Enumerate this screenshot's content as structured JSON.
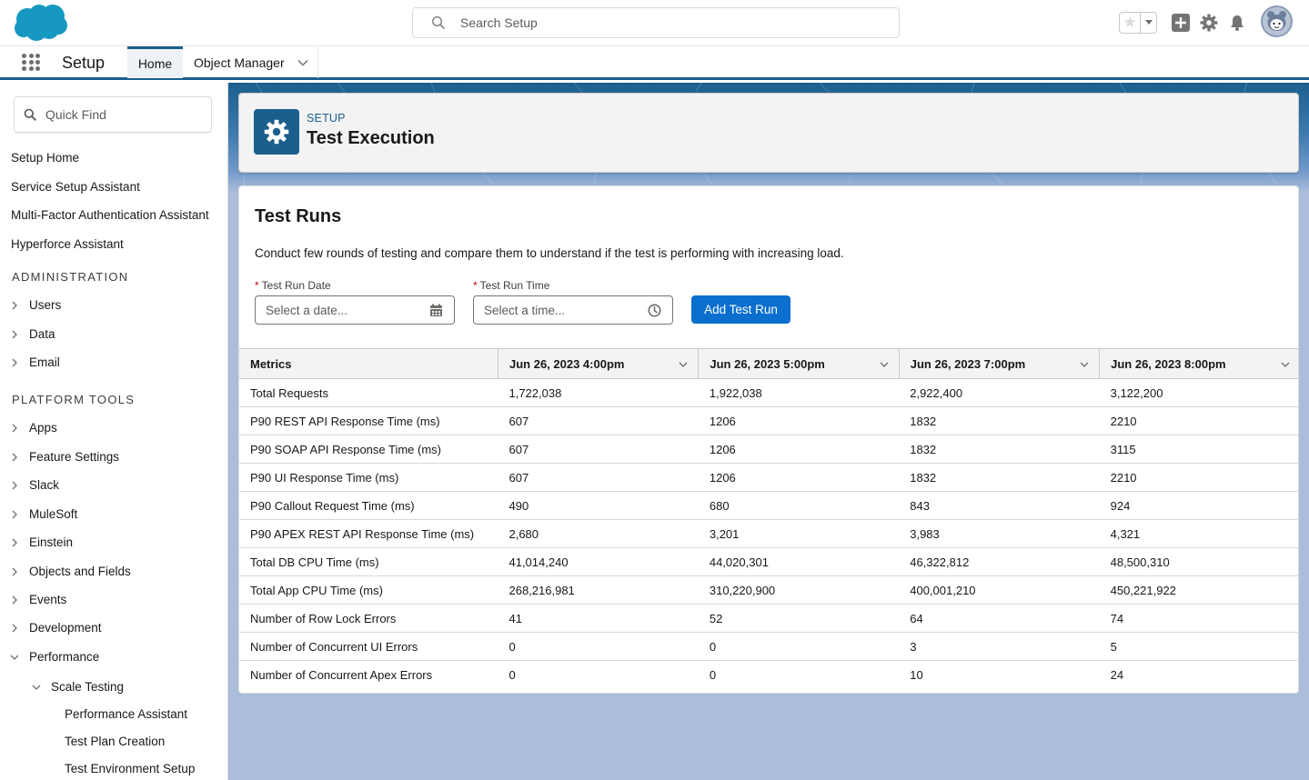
{
  "header": {
    "logo": "salesforce-cloud-logo",
    "search_placeholder": "Search Setup",
    "icons": [
      "favorites-star-icon",
      "favorites-dropdown-icon",
      "global-actions-plus-icon",
      "setup-gear-icon",
      "notifications-bell-icon",
      "user-avatar"
    ]
  },
  "context_bar": {
    "app_name": "Setup",
    "tabs": [
      {
        "label": "Home",
        "active": true
      },
      {
        "label": "Object Manager",
        "active": false,
        "has_menu": true
      }
    ]
  },
  "sidebar": {
    "quick_find_placeholder": "Quick Find",
    "top_links": [
      "Setup Home",
      "Service Setup Assistant",
      "Multi-Factor Authentication Assistant",
      "Hyperforce Assistant"
    ],
    "sections": [
      {
        "title": "ADMINISTRATION",
        "items": [
          {
            "label": "Users",
            "expanded": false
          },
          {
            "label": "Data",
            "expanded": false
          },
          {
            "label": "Email",
            "expanded": false
          }
        ]
      },
      {
        "title": "PLATFORM TOOLS",
        "items": [
          {
            "label": "Apps",
            "expanded": false
          },
          {
            "label": "Feature Settings",
            "expanded": false
          },
          {
            "label": "Slack",
            "expanded": false
          },
          {
            "label": "MuleSoft",
            "expanded": false
          },
          {
            "label": "Einstein",
            "expanded": false
          },
          {
            "label": "Objects and Fields",
            "expanded": false
          },
          {
            "label": "Events",
            "expanded": false
          },
          {
            "label": "Development",
            "expanded": false
          },
          {
            "label": "Performance",
            "expanded": true
          }
        ]
      }
    ],
    "performance_children": {
      "label": "Scale Testing",
      "expanded": true,
      "children": [
        "Performance Assistant",
        "Test Plan Creation",
        "Test Environment Setup"
      ]
    }
  },
  "page_header": {
    "eyebrow": "SETUP",
    "title": "Test Execution",
    "icon": "gear-icon"
  },
  "card": {
    "title": "Test Runs",
    "description": "Conduct few rounds of testing and compare them to understand if the test is performing with increasing load.",
    "date_field": {
      "label": "Test Run Date",
      "required_marker": "*",
      "placeholder": "Select a date...",
      "value": ""
    },
    "time_field": {
      "label": "Test Run Time",
      "required_marker": "*",
      "placeholder": "Select a time...",
      "value": ""
    },
    "add_button": "Add Test Run"
  },
  "table": {
    "columns": [
      "Metrics",
      "Jun 26, 2023 4:00pm",
      "Jun 26, 2023 5:00pm",
      "Jun 26, 2023 7:00pm",
      "Jun 26, 2023 8:00pm"
    ],
    "rows": [
      [
        "Total Requests",
        "1,722,038",
        "1,922,038",
        "2,922,400",
        "3,122,200"
      ],
      [
        "P90 REST API Response Time (ms)",
        "607",
        "1206",
        "1832",
        "2210"
      ],
      [
        "P90 SOAP API Response Time (ms)",
        "607",
        "1206",
        "1832",
        "3115"
      ],
      [
        "P90 UI Response Time (ms)",
        "607",
        "1206",
        "1832",
        "2210"
      ],
      [
        "P90 Callout Request Time (ms)",
        "490",
        "680",
        "843",
        "924"
      ],
      [
        "P90 APEX REST API Response Time (ms)",
        "2,680",
        "3,201",
        "3,983",
        "4,321"
      ],
      [
        "Total DB CPU Time (ms)",
        "41,014,240",
        "44,020,301",
        "46,322,812",
        "48,500,310"
      ],
      [
        "Total App CPU Time (ms)",
        "268,216,981",
        "310,220,900",
        "400,001,210",
        "450,221,922"
      ],
      [
        "Number of Row Lock Errors",
        "41",
        "52",
        "64",
        "74"
      ],
      [
        "Number of Concurrent UI Errors",
        "0",
        "0",
        "3",
        "5"
      ],
      [
        "Number of Concurrent Apex Errors",
        "0",
        "0",
        "10",
        "24"
      ]
    ]
  },
  "colors": {
    "brand": "#0b6fcf",
    "header_accent": "#1b5f8d",
    "background": "#aabdda",
    "required": "#ba0517"
  }
}
